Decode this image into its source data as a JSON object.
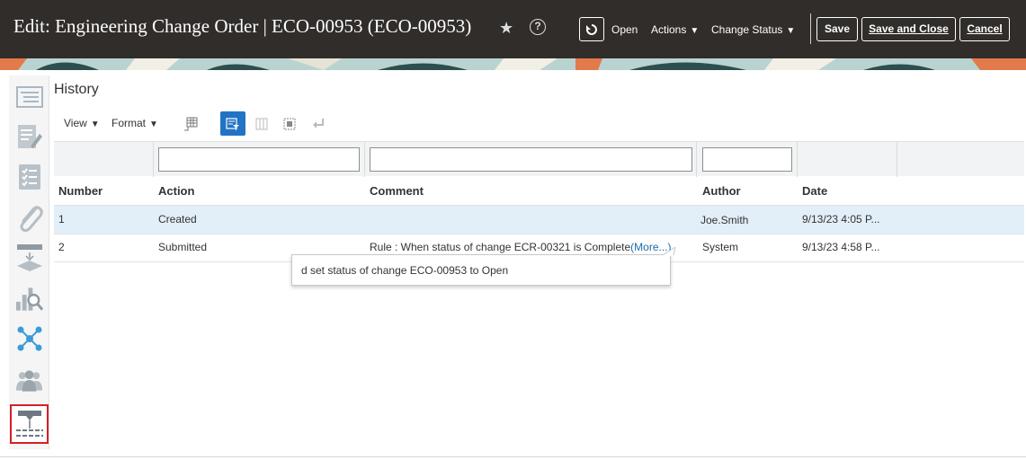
{
  "header": {
    "title": "Edit: Engineering Change Order | ECO-00953 (ECO-00953)",
    "status_label": "Open",
    "actions_label": "Actions",
    "change_status_label": "Change Status",
    "save_label": "Save",
    "save_close_label": "Save and Close",
    "cancel_label": "Cancel"
  },
  "sidebar": {
    "items": [
      {
        "icon": "overview-icon"
      },
      {
        "icon": "edit-document-icon"
      },
      {
        "icon": "checklist-icon"
      },
      {
        "icon": "attachment-icon"
      },
      {
        "icon": "change-lines-icon"
      },
      {
        "icon": "search-analysis-icon"
      },
      {
        "icon": "relationships-icon"
      },
      {
        "icon": "team-icon"
      },
      {
        "icon": "history-icon",
        "selected": true
      }
    ]
  },
  "history": {
    "title": "History",
    "toolbar": {
      "view_label": "View",
      "format_label": "Format"
    },
    "columns": [
      "Number",
      "Action",
      "Comment",
      "Author",
      "Date"
    ],
    "rows": [
      {
        "number": "1",
        "action": "Created",
        "comment": "",
        "author": "Joe.Smith",
        "date": "9/13/23 4:05 P..."
      },
      {
        "number": "2",
        "action": "Submitted",
        "comment": "Rule : When status of change ECR-00321 is Complete",
        "more": "(More...)",
        "author": "System",
        "date": "9/13/23 4:58 P..."
      }
    ],
    "tooltip": "d set status of change ECO-00953 to Open"
  },
  "colors": {
    "header_bg": "#312d2a",
    "accent": "#2373c4",
    "selected_row": "#e2eef8",
    "selection_border": "#d71f26",
    "link": "#1a6cae"
  }
}
